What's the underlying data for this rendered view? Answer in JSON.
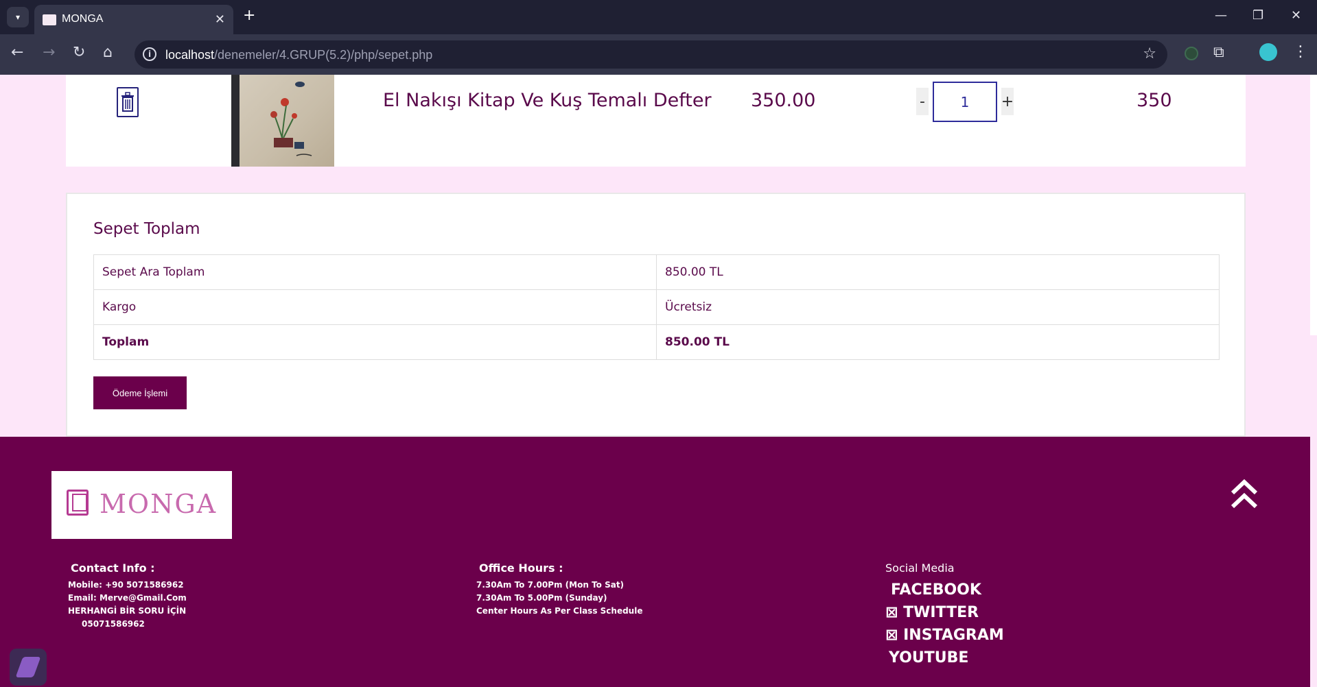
{
  "browser": {
    "tab_title": "MONGA",
    "url_host": "localhost",
    "url_path": "/denemeler/4.GRUP(5.2)/php/sepet.php"
  },
  "cart": {
    "item": {
      "name": "El Nakışı Kitap Ve Kuş Temalı Defter",
      "price": "350.00",
      "quantity": "1",
      "minus_label": "-",
      "plus_label": "+",
      "total": "350"
    }
  },
  "totals": {
    "title": "Sepet Toplam",
    "rows": [
      {
        "label": "Sepet Ara Toplam",
        "value": "850.00 TL"
      },
      {
        "label": "Kargo",
        "value": "Ücretsiz"
      },
      {
        "label": "Toplam",
        "value": "850.00 TL"
      }
    ],
    "checkout_label": "Ödeme İşlemi"
  },
  "footer": {
    "logo_text": "MONGA",
    "contact": {
      "heading": "Contact Info :",
      "mobile": "Mobile: +90 5071586962",
      "email": "Email: Merve@Gmail.Com",
      "question": "HERHANGİ BİR SORU İÇİN",
      "phone": "05071586962"
    },
    "office": {
      "heading": "Office Hours :",
      "line1": "7.30Am To 7.00Pm (Mon To Sat)",
      "line2": "7.30Am To 5.00Pm (Sunday)",
      "line3": "Center Hours As Per Class Schedule"
    },
    "social": {
      "heading": "Social Media",
      "facebook": "FACEBOOK",
      "twitter": "⊠ TWITTER",
      "instagram": "⊠ INSTAGRAM",
      "youtube": "YOUTUBE"
    }
  }
}
